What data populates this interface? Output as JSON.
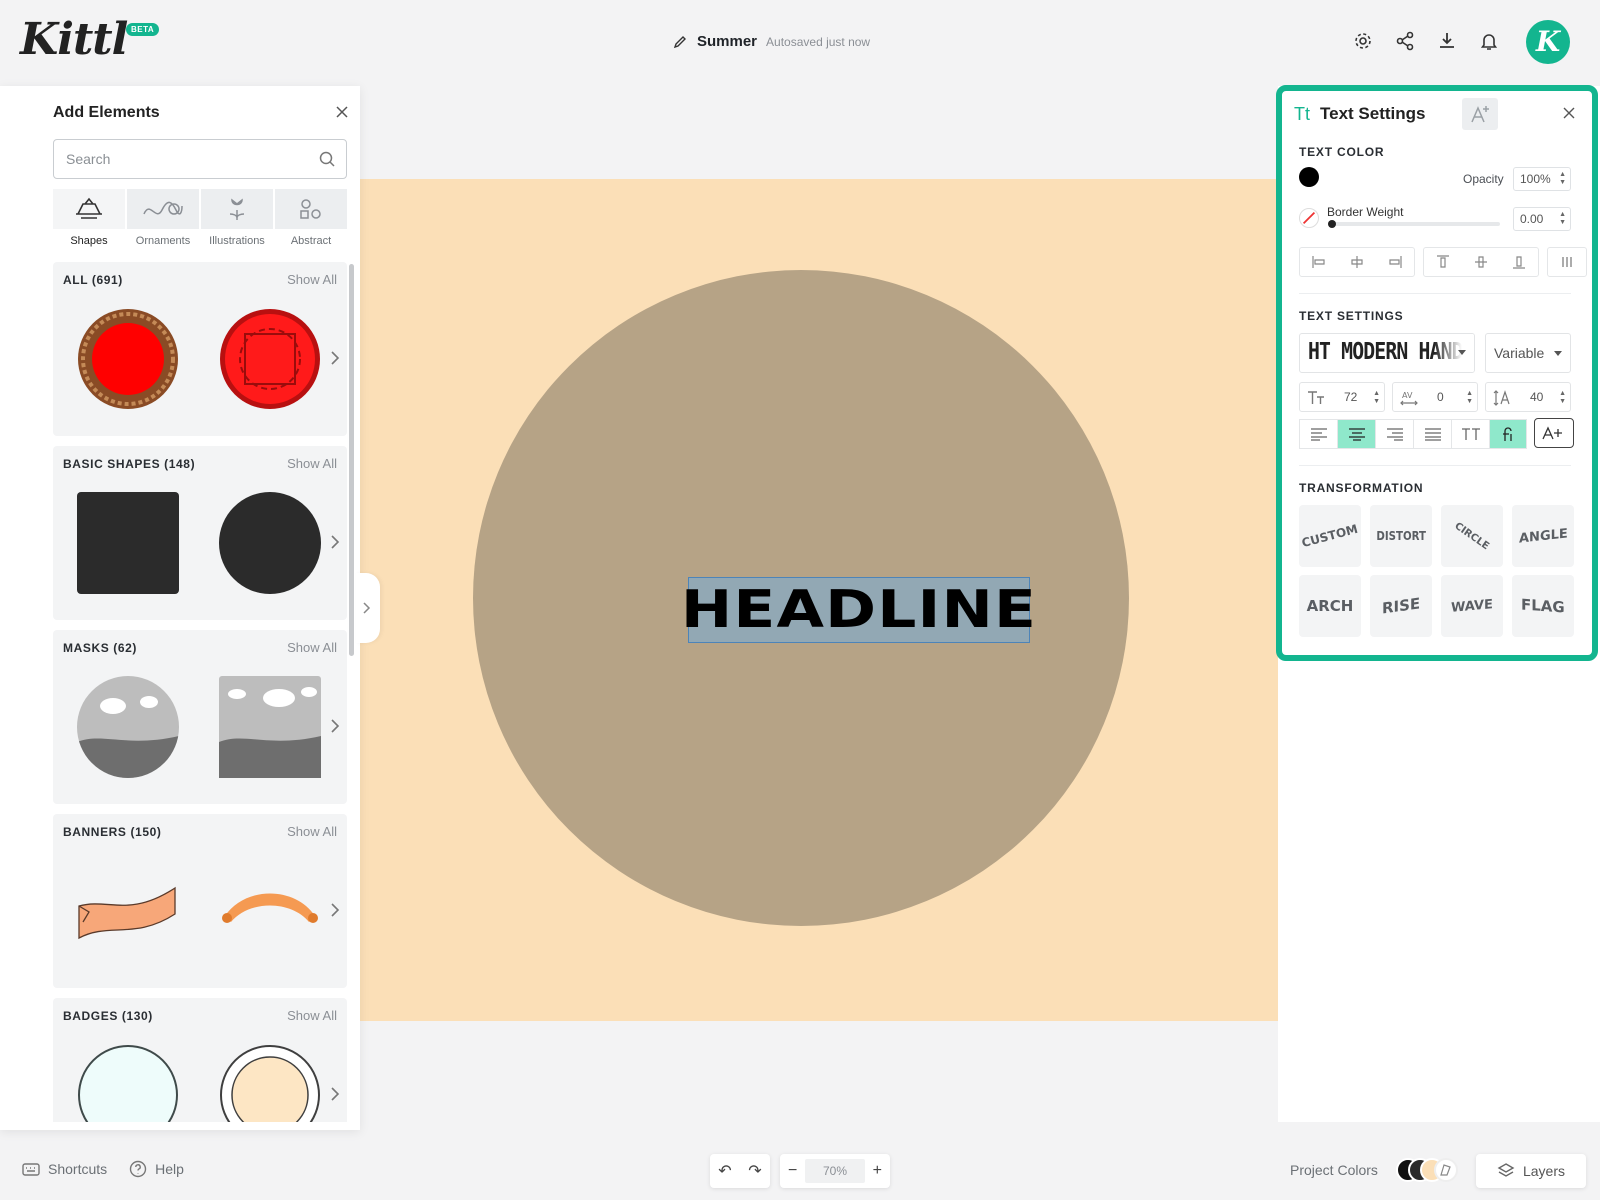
{
  "app": {
    "logo_text": "Kittl",
    "beta_badge": "BETA",
    "avatar_letter": "K"
  },
  "header": {
    "project_name": "Summer",
    "autosave_status": "Autosaved just now",
    "icons": [
      "pencil-icon",
      "gear-icon",
      "share-icon",
      "download-icon",
      "bell-icon"
    ]
  },
  "rail": {
    "icons": [
      "edit-icon",
      "templates-icon",
      "text-icon",
      "elements-icon",
      "upload-icon",
      "camera-icon",
      "grid-icon"
    ]
  },
  "add_elements": {
    "title": "Add Elements",
    "search_placeholder": "Search",
    "categories": [
      {
        "label": "Shapes",
        "active": true
      },
      {
        "label": "Ornaments",
        "active": false
      },
      {
        "label": "Illustrations",
        "active": false
      },
      {
        "label": "Abstract",
        "active": false
      }
    ],
    "show_all_label": "Show All",
    "sections": [
      {
        "title": "ALL (691)"
      },
      {
        "title": "BASIC SHAPES (148)"
      },
      {
        "title": "MASKS (62)"
      },
      {
        "title": "BANNERS (150)"
      },
      {
        "title": "BADGES (130)"
      }
    ]
  },
  "canvas": {
    "headline_text": "HEADLINE",
    "background_color": "#fbdfb7",
    "circle_color": "#b6a386"
  },
  "text_settings": {
    "title": "Text Settings",
    "text_color_label": "TEXT COLOR",
    "opacity_label": "Opacity",
    "opacity_value": "100%",
    "border_weight_label": "Border Weight",
    "border_weight_value": "0.00",
    "text_settings_label": "TEXT SETTINGS",
    "font_name": "HT MODERN HAND",
    "font_weight": "Variable",
    "font_size": "72",
    "letter_spacing": "0",
    "line_height": "40",
    "transformation_label": "TRANSFORMATION",
    "transformations": [
      "CUSTOM",
      "DISTORT",
      "CIRCLE",
      "ANGLE",
      "ARCH",
      "RISE",
      "WAVE",
      "FLAG"
    ],
    "accent_color": "#13b58f"
  },
  "bottom": {
    "shortcuts_label": "Shortcuts",
    "help_label": "Help",
    "zoom_value": "70%",
    "project_colors_label": "Project Colors",
    "layers_label": "Layers",
    "project_colors": [
      "#111111",
      "#2b2b2b",
      "#fbdfb7"
    ]
  }
}
